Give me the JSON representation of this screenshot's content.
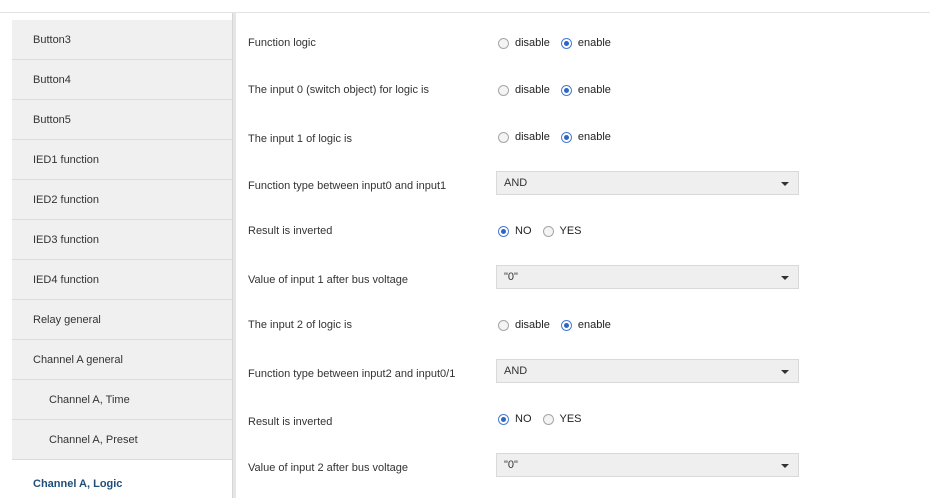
{
  "sidebar": {
    "items": [
      {
        "label": "Button3"
      },
      {
        "label": "Button4"
      },
      {
        "label": "Button5"
      },
      {
        "label": "IED1 function"
      },
      {
        "label": "IED2 function"
      },
      {
        "label": "IED3 function"
      },
      {
        "label": "IED4 function"
      },
      {
        "label": "Relay general"
      },
      {
        "label": "Channel A general"
      },
      {
        "label": "Channel A, Time"
      },
      {
        "label": "Channel A, Preset"
      },
      {
        "label": "Channel A, Logic"
      }
    ],
    "active": "Channel A, Logic"
  },
  "params": {
    "function_logic": {
      "label": "Function logic",
      "opt1": "disable",
      "opt2": "enable",
      "selected": "enable"
    },
    "input0": {
      "label": "The input 0 (switch object) for logic is",
      "opt1": "disable",
      "opt2": "enable",
      "selected": "enable"
    },
    "input1": {
      "label": "The input 1 of logic is",
      "opt1": "disable",
      "opt2": "enable",
      "selected": "enable"
    },
    "func_type_0_1": {
      "label": "Function type between input0 and input1",
      "value": "AND"
    },
    "result_inverted_1": {
      "label": "Result is inverted",
      "opt1": "NO",
      "opt2": "YES",
      "selected": "NO"
    },
    "value_input1": {
      "label": "Value of input 1 after bus voltage",
      "value": "\"0\""
    },
    "input2": {
      "label": "The input 2 of logic is",
      "opt1": "disable",
      "opt2": "enable",
      "selected": "enable"
    },
    "func_type_2_01": {
      "label": "Function type between input2 and input0/1",
      "value": "AND"
    },
    "result_inverted_2": {
      "label": "Result is inverted",
      "opt1": "NO",
      "opt2": "YES",
      "selected": "NO"
    },
    "value_input2": {
      "label": "Value of input 2 after bus voltage",
      "value": "\"0\""
    }
  }
}
